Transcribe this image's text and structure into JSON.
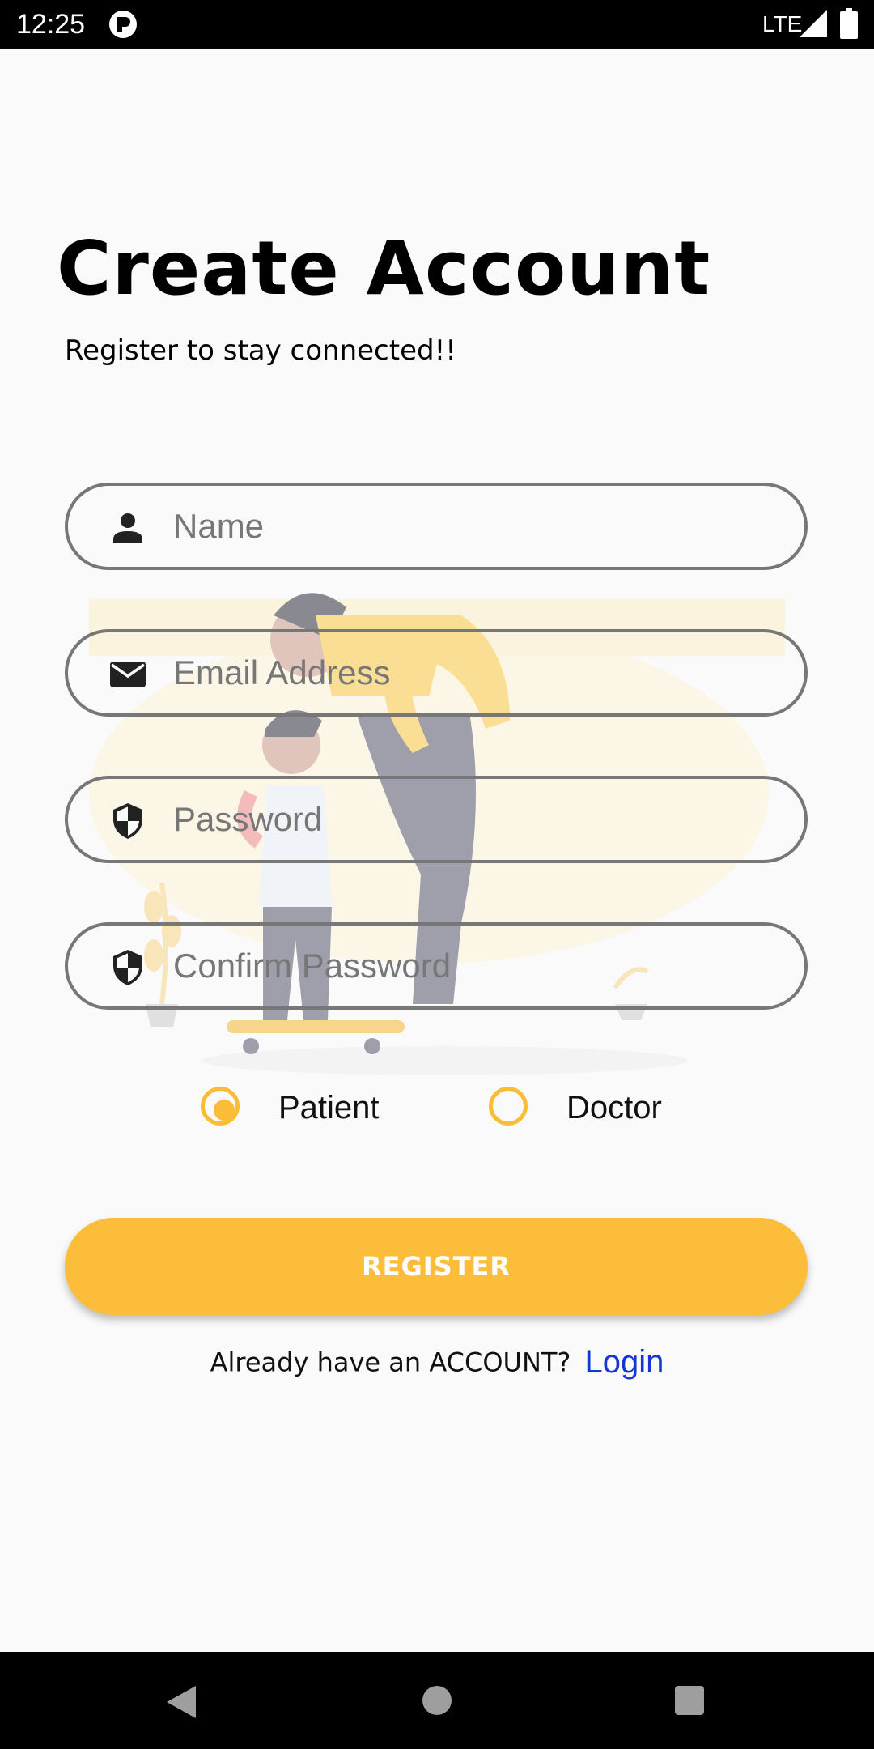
{
  "status_bar": {
    "time": "12:25",
    "network": "LTE",
    "icons": [
      "app-notification-icon",
      "signal-icon",
      "battery-icon"
    ]
  },
  "header": {
    "title": "Create Account",
    "subtitle": "Register to stay connected!!"
  },
  "form": {
    "name": {
      "placeholder": "Name",
      "value": "",
      "icon": "person-icon"
    },
    "email": {
      "placeholder": "Email Address",
      "value": "",
      "icon": "mail-icon"
    },
    "password": {
      "placeholder": "Password",
      "value": "",
      "icon": "shield-icon"
    },
    "confirm_password": {
      "placeholder": "Confirm Password",
      "value": "",
      "icon": "shield-icon"
    }
  },
  "role": {
    "options": [
      {
        "label": "Patient",
        "selected": true
      },
      {
        "label": "Doctor",
        "selected": false
      }
    ]
  },
  "actions": {
    "register_label": "REGISTER",
    "login_prompt": "Already have an ACCOUNT?",
    "login_label": "Login"
  },
  "colors": {
    "accent": "#fcbd3a",
    "link": "#1336d6",
    "field_border": "#777777",
    "background": "#fafafa"
  },
  "nav_bar": {
    "icons": [
      "back-icon",
      "home-icon",
      "recents-icon"
    ]
  }
}
